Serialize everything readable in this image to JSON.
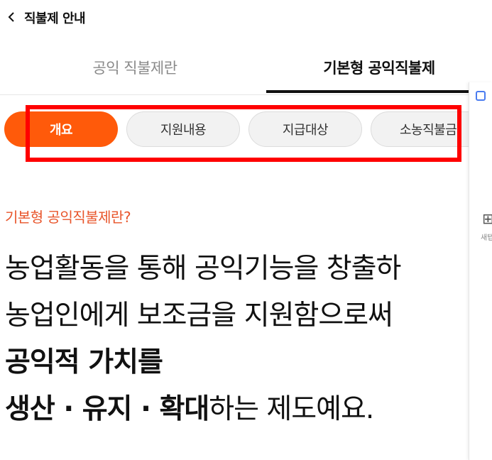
{
  "header": {
    "title": "직불제 안내"
  },
  "main_tabs": [
    {
      "label": "공익 직불제란",
      "active": false
    },
    {
      "label": "기본형 공익직불제",
      "active": true
    }
  ],
  "chips": [
    {
      "label": "개요",
      "active": true
    },
    {
      "label": "지원내용",
      "active": false
    },
    {
      "label": "지급대상",
      "active": false
    },
    {
      "label": "소농직불금",
      "active": false
    }
  ],
  "side_panel": {
    "label": "새탭"
  },
  "content": {
    "subtitle": "기본형 공익직불제란?",
    "line1": "농업활동을 통해 공익기능을 창출하",
    "line2": "농업인에게 보조금을 지원함으로써",
    "line3_bold": "공익적 가치를",
    "line4_bold": "생산 · 유지 · 확대",
    "line4_rest": "하는 제도예요."
  },
  "colors": {
    "accent": "#ff5a0a",
    "subtitle": "#e8542a",
    "highlight": "#ff0000"
  }
}
